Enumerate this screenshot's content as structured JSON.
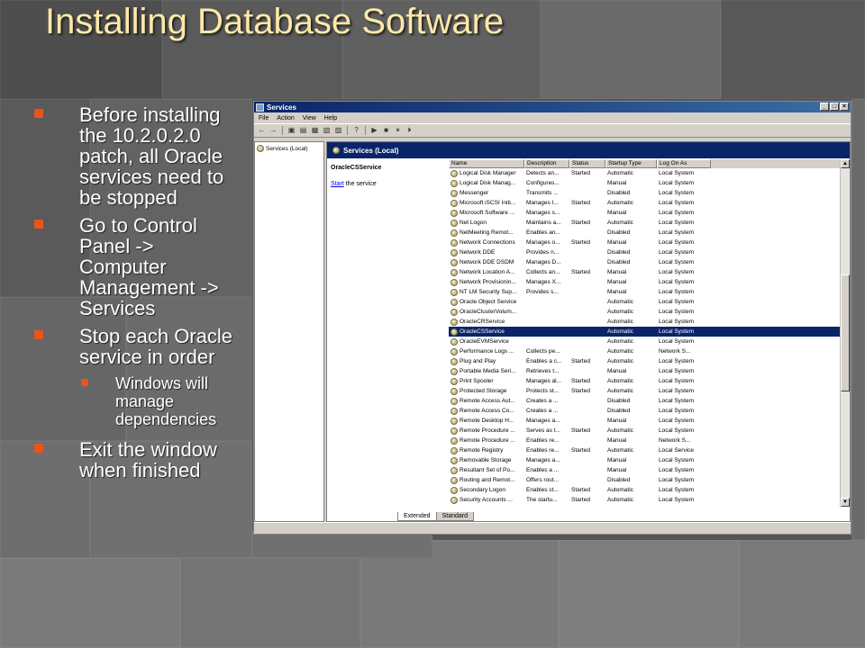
{
  "slide": {
    "title": "Installing Database Software",
    "bullets": [
      "Before installing the 10.2.0.2.0 patch, all Oracle services need to be stopped",
      "Go to Control Panel -> Computer Management -> Services",
      "Stop each Oracle service in order"
    ],
    "sub_bullet": "Windows will manage dependencies",
    "last_bullet": "Exit the window when finished"
  },
  "window": {
    "title": "Services",
    "menu": [
      "File",
      "Action",
      "View",
      "Help"
    ],
    "tree_root": "Services (Local)",
    "header": "Services (Local)",
    "selected_service": "OracleCSService",
    "start_link": "Start",
    "start_suffix": " the service",
    "columns": [
      "Name",
      "Description",
      "Status",
      "Startup Type",
      "Log On As"
    ],
    "tabs": [
      "Extended",
      "Standard"
    ],
    "rows": [
      [
        "Logical Disk Manager",
        "Detects an...",
        "Started",
        "Automatic",
        "Local System"
      ],
      [
        "Logical Disk Manag...",
        "Configures...",
        "",
        "Manual",
        "Local System"
      ],
      [
        "Messenger",
        "Transmits ...",
        "",
        "Disabled",
        "Local System"
      ],
      [
        "Microsoft iSCSI Initi...",
        "Manages I...",
        "Started",
        "Automatic",
        "Local System"
      ],
      [
        "Microsoft Software ...",
        "Manages s...",
        "",
        "Manual",
        "Local System"
      ],
      [
        "Net Logon",
        "Maintains a...",
        "Started",
        "Automatic",
        "Local System"
      ],
      [
        "NetMeeting Remot...",
        "Enables an...",
        "",
        "Disabled",
        "Local System"
      ],
      [
        "Network Connections",
        "Manages o...",
        "Started",
        "Manual",
        "Local System"
      ],
      [
        "Network DDE",
        "Provides n...",
        "",
        "Disabled",
        "Local System"
      ],
      [
        "Network DDE DSDM",
        "Manages D...",
        "",
        "Disabled",
        "Local System"
      ],
      [
        "Network Location A...",
        "Collects an...",
        "Started",
        "Manual",
        "Local System"
      ],
      [
        "Network Provisionin...",
        "Manages X...",
        "",
        "Manual",
        "Local System"
      ],
      [
        "NT LM Security Sup...",
        "Provides s...",
        "",
        "Manual",
        "Local System"
      ],
      [
        "Oracle Object Service",
        "",
        "",
        "Automatic",
        "Local System"
      ],
      [
        "OracleClusterVolum...",
        "",
        "",
        "Automatic",
        "Local System"
      ],
      [
        "OracleCRService",
        "",
        "",
        "Automatic",
        "Local System"
      ],
      [
        "OracleCSService",
        "",
        "",
        "Automatic",
        "Local System"
      ],
      [
        "OracleEVMService",
        "",
        "",
        "Automatic",
        "Local System"
      ],
      [
        "Performance Logs ...",
        "Collects pe...",
        "",
        "Automatic",
        "Network S..."
      ],
      [
        "Plug and Play",
        "Enables a c...",
        "Started",
        "Automatic",
        "Local System"
      ],
      [
        "Portable Media Seri...",
        "Retrieves t...",
        "",
        "Manual",
        "Local System"
      ],
      [
        "Print Spooler",
        "Manages al...",
        "Started",
        "Automatic",
        "Local System"
      ],
      [
        "Protected Storage",
        "Protects st...",
        "Started",
        "Automatic",
        "Local System"
      ],
      [
        "Remote Access Aut...",
        "Creates a ...",
        "",
        "Disabled",
        "Local System"
      ],
      [
        "Remote Access Co...",
        "Creates a ...",
        "",
        "Disabled",
        "Local System"
      ],
      [
        "Remote Desktop H...",
        "Manages a...",
        "",
        "Manual",
        "Local System"
      ],
      [
        "Remote Procedure ...",
        "Serves as t...",
        "Started",
        "Automatic",
        "Local System"
      ],
      [
        "Remote Procedure ...",
        "Enables re...",
        "",
        "Manual",
        "Network S..."
      ],
      [
        "Remote Registry",
        "Enables re...",
        "Started",
        "Automatic",
        "Local Service"
      ],
      [
        "Removable Storage",
        "Manages a...",
        "",
        "Manual",
        "Local System"
      ],
      [
        "Resultant Set of Po...",
        "Enables a ...",
        "",
        "Manual",
        "Local System"
      ],
      [
        "Routing and Remot...",
        "Offers rout...",
        "",
        "Disabled",
        "Local System"
      ],
      [
        "Secondary Logon",
        "Enables st...",
        "Started",
        "Automatic",
        "Local System"
      ],
      [
        "Security Accounts ...",
        "The startu...",
        "Started",
        "Automatic",
        "Local System"
      ]
    ],
    "selected_row_index": 16
  },
  "colors": {
    "title": "#ffe9a8",
    "bullet": "#e8541e",
    "selection": "#0a246a"
  }
}
